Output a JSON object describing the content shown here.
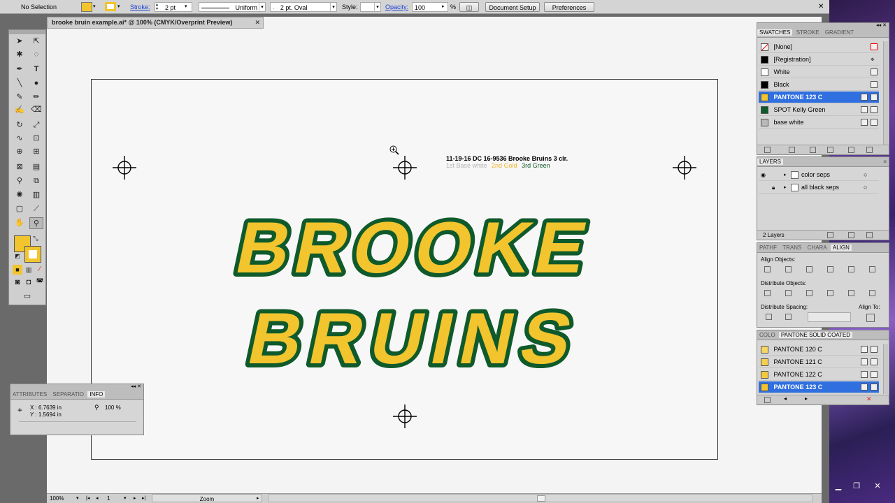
{
  "control_bar": {
    "selection": "No Selection",
    "stroke_label": "Stroke:",
    "stroke_weight": "2 pt",
    "profile": "Uniform",
    "brush": "2 pt. Oval",
    "style_label": "Style:",
    "opacity_label": "Opacity:",
    "opacity_value": "100",
    "opacity_unit": "%",
    "document_setup": "Document Setup",
    "preferences": "Preferences"
  },
  "document": {
    "tab_title": "brooke bruin example.ai* @ 100% (CMYK/Overprint Preview)",
    "job_line1": "11-19-16   DC 16-9536   Brooke Bruins   3 clr.",
    "job_color1": "1st Base white",
    "job_color2": "2nd Gold",
    "job_color3": "3rd Green",
    "art_line1": "BROOKE",
    "art_line2": "BRUINS"
  },
  "colors": {
    "gold": "#F2C42E",
    "green": "#0F5A2B",
    "selection_blue": "#2F6FE0",
    "workspace": "#F4F4F4"
  },
  "attributes_panel": {
    "tabs": [
      "ATTRIBUTES",
      "SEPARATIO",
      "INFO"
    ],
    "x_label": "X :",
    "x_value": "6.7639 in",
    "y_label": "Y :",
    "y_value": "1.5694 in",
    "zoom_value": "100 %"
  },
  "swatches_panel": {
    "tabs": [
      "SWATCHES",
      "STROKE",
      "GRADIENT"
    ],
    "items": [
      {
        "name": "[None]",
        "color": "#FFFFFF"
      },
      {
        "name": "[Registration]",
        "color": "#000000"
      },
      {
        "name": "White",
        "color": "#FFFFFF"
      },
      {
        "name": "Black",
        "color": "#000000"
      },
      {
        "name": "PANTONE 123 C",
        "color": "#F2C42E"
      },
      {
        "name": "SPOT Kelly Green",
        "color": "#0F5A2B"
      },
      {
        "name": "base white",
        "color": "#B9B9B9"
      }
    ]
  },
  "layers_panel": {
    "title": "LAYERS",
    "layers": [
      "color seps",
      "all black seps"
    ],
    "count": "2 Layers"
  },
  "align_panel": {
    "tabs": [
      "PATHF",
      "TRANS",
      "CHARA",
      "ALIGN"
    ],
    "align_objects": "Align Objects:",
    "distribute_objects": "Distribute Objects:",
    "distribute_spacing": "Distribute Spacing:",
    "align_to": "Align To:"
  },
  "color_panel": {
    "tabs": [
      "COLO",
      "PANTONE SOLID COATED"
    ],
    "items": [
      {
        "name": "PANTONE 120 C",
        "color": "#F5D766"
      },
      {
        "name": "PANTONE 121 C",
        "color": "#F5D050"
      },
      {
        "name": "PANTONE 122 C",
        "color": "#F3C940"
      },
      {
        "name": "PANTONE 123 C",
        "color": "#F2C42E"
      }
    ]
  },
  "status_bar": {
    "zoom": "100%",
    "page": "1",
    "tool": "Zoom"
  }
}
